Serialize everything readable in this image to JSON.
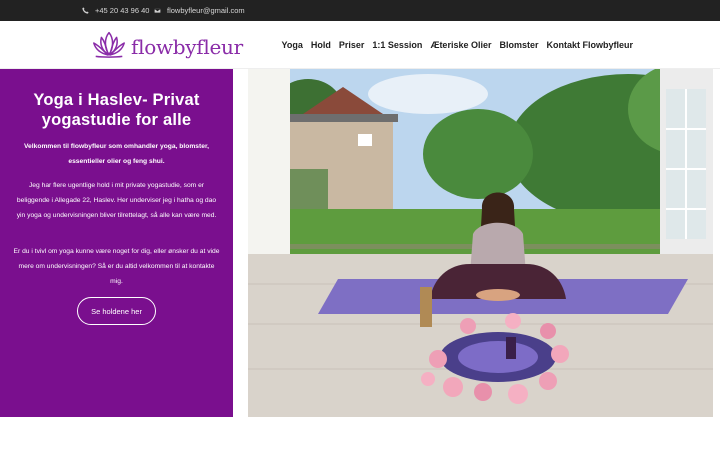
{
  "topbar": {
    "phone": "+45 20 43 96 40",
    "email": "flowbyfleur@gmail.com",
    "phone_icon": "phone-icon",
    "email_icon": "envelope-icon"
  },
  "brand": {
    "name": "flowbyfleur",
    "logo_icon": "lotus-icon",
    "color": "#8a2ca8"
  },
  "nav": {
    "items": [
      {
        "label": "Yoga"
      },
      {
        "label": "Hold"
      },
      {
        "label": "Priser"
      },
      {
        "label": "1:1 Session"
      },
      {
        "label": "Æteriske Olier"
      },
      {
        "label": "Blomster"
      },
      {
        "label": "Kontakt Flowbyfleur"
      }
    ]
  },
  "hero": {
    "title": "Yoga i Haslev- Privat yogastudie for alle",
    "intro": "Velkommen til flowbyfleur som omhandler yoga, blomster, essentieller olier og feng shui.",
    "paragraph1": "Jeg har flere ugentlige hold i mit private yogastudie, som er beliggende i Allegade 22, Haslev. Her underviser jeg i hatha og dao yin yoga og undervisningen bliver tilrettelagt, så alle kan være med.",
    "paragraph2": "Er du i tvivl om yoga kunne være noget for dig, eller ønsker du at vide mere om undervisningen? Så er du altid velkommen til at kontakte mig.",
    "button_label": "Se holdene her",
    "panel_color": "#7a0f8e"
  }
}
